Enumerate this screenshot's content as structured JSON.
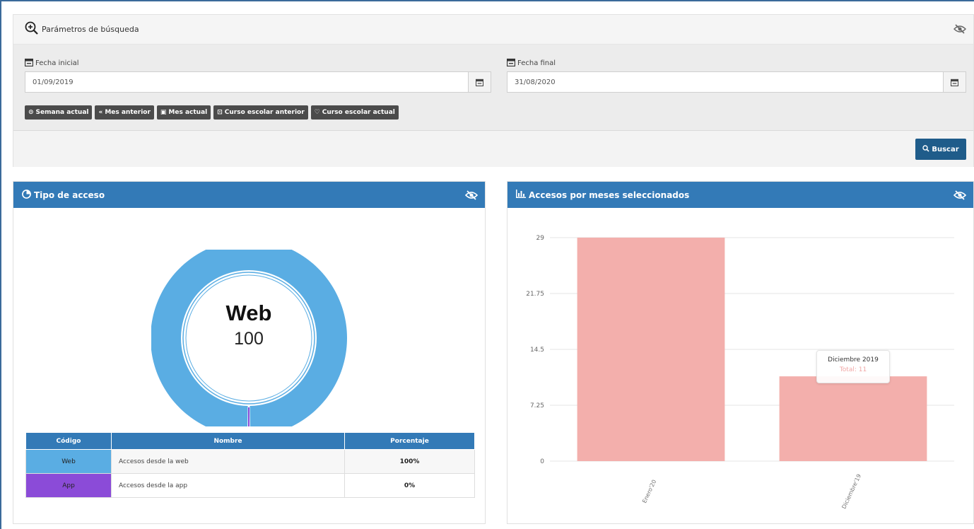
{
  "search": {
    "title": "Parámetros de búsqueda",
    "start_label": "Fecha inicial",
    "start_value": "01/09/2019",
    "end_label": "Fecha final",
    "end_value": "31/08/2020",
    "quick_buttons": [
      "Semana actual",
      "Mes anterior",
      "Mes actual",
      "Curso escolar anterior",
      "Curso escolar actual"
    ],
    "search_button": "Buscar"
  },
  "access_panel": {
    "title": "Tipo de acceso",
    "center_label": "Web",
    "center_value": "100",
    "table": {
      "headers": [
        "Código",
        "Nombre",
        "Porcentaje"
      ],
      "rows": [
        {
          "code": "Web",
          "name": "Accesos desde la web",
          "pct": "100%",
          "color": "#5aade3"
        },
        {
          "code": "App",
          "name": "Accesos desde la app",
          "pct": "0%",
          "color": "#8b4bd8"
        }
      ]
    }
  },
  "months_panel": {
    "title": "Accesos por meses seleccionados",
    "tooltip_title": "Diciembre 2019",
    "tooltip_value": "Total: 11"
  },
  "chart_data": [
    {
      "type": "pie",
      "labels": [
        "Web",
        "App"
      ],
      "values": [
        100,
        0
      ],
      "colors": [
        "#5aade3",
        "#8b4bd8"
      ]
    },
    {
      "type": "bar",
      "categories": [
        "Enero'20",
        "Diciembre'19"
      ],
      "values": [
        29,
        11
      ],
      "yticks": [
        "29",
        "21.75",
        "14.5",
        "7.25",
        "0"
      ],
      "ylim": [
        0,
        29
      ],
      "grid": true,
      "color": "#f3afac"
    }
  ]
}
